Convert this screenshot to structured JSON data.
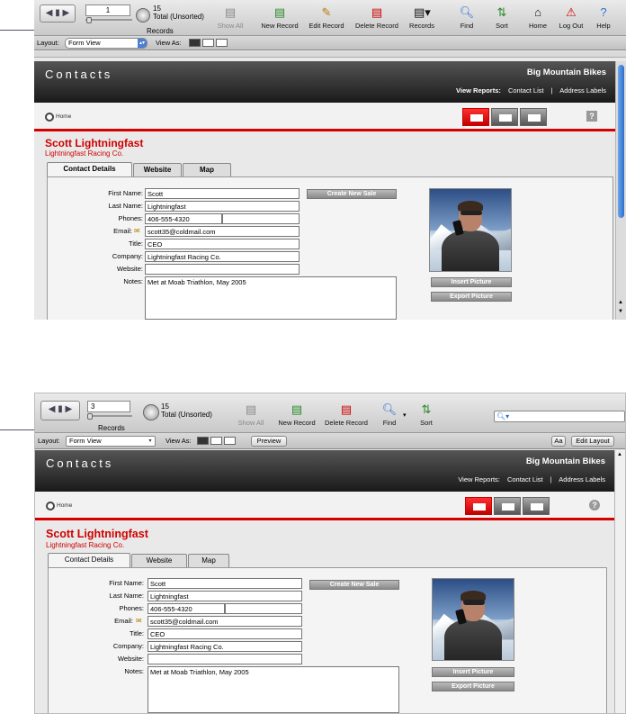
{
  "panel1": {
    "toolbar": {
      "record_number": "1",
      "total_count": "15",
      "total_state": "Total (Unsorted)",
      "records_label": "Records",
      "buttons": [
        {
          "label": "Show All",
          "icon": "show-all-icon",
          "enabled": false
        },
        {
          "label": "New Record",
          "icon": "new-record-icon",
          "enabled": true
        },
        {
          "label": "Edit Record",
          "icon": "edit-record-icon",
          "enabled": true
        },
        {
          "label": "Delete Record",
          "icon": "delete-record-icon",
          "enabled": true
        },
        {
          "label": "Records",
          "icon": "records-menu-icon",
          "enabled": true
        },
        {
          "label": "Find",
          "icon": "find-icon",
          "enabled": true
        },
        {
          "label": "Sort",
          "icon": "sort-icon",
          "enabled": true
        },
        {
          "label": "Home",
          "icon": "home-icon",
          "enabled": true
        },
        {
          "label": "Log Out",
          "icon": "log-out-icon",
          "enabled": true
        },
        {
          "label": "Help",
          "icon": "help-icon",
          "enabled": true
        }
      ]
    },
    "layout_bar": {
      "layout_label": "Layout:",
      "layout_value": "Form View",
      "view_as_label": "View As:"
    }
  },
  "panel2": {
    "toolbar": {
      "record_number": "3",
      "total_count": "15",
      "total_state": "Total (Unsorted)",
      "records_label": "Records",
      "buttons": [
        {
          "label": "Show All",
          "icon": "show-all-icon",
          "enabled": false
        },
        {
          "label": "New Record",
          "icon": "new-record-icon",
          "enabled": true
        },
        {
          "label": "Delete Record",
          "icon": "delete-record-icon",
          "enabled": true
        },
        {
          "label": "Find",
          "icon": "find-icon",
          "enabled": true
        },
        {
          "label": "Sort",
          "icon": "sort-icon",
          "enabled": true
        }
      ],
      "search_placeholder": ""
    },
    "layout_bar": {
      "layout_label": "Layout:",
      "layout_value": "Form View",
      "view_as_label": "View As:",
      "preview_label": "Preview",
      "text_format_label": "Aa",
      "edit_layout_label": "Edit Layout"
    }
  },
  "content": {
    "header_title": "Contacts",
    "company": "Big Mountain Bikes",
    "view_reports_label": "View Reports:",
    "contact_list_link": "Contact List",
    "separator": "|",
    "address_labels_link": "Address Labels",
    "home_label": "Home",
    "help_label": "?",
    "contact_name": "Scott Lightningfast",
    "contact_company": "Lightningfast Racing Co.",
    "tabs": [
      "Contact Details",
      "Website",
      "Map"
    ],
    "fields": [
      {
        "label": "First Name:",
        "value": "Scott"
      },
      {
        "label": "Last Name:",
        "value": "Lightningfast"
      },
      {
        "label": "Phones:",
        "value": "406-555-4320"
      },
      {
        "label": "Email:",
        "value": "scott35@coldmail.com"
      },
      {
        "label": "Title:",
        "value": "CEO"
      },
      {
        "label": "Company:",
        "value": "Lightningfast Racing Co."
      },
      {
        "label": "Website:",
        "value": ""
      },
      {
        "label": "Notes:",
        "value": "Met at Moab Triathlon, May 2005"
      }
    ],
    "create_sale_button": "Create New Sale",
    "insert_picture_button": "Insert Picture",
    "export_picture_button": "Export Picture"
  },
  "colors": {
    "accent_red": "#d40000",
    "header_dark": "#1a1a1a"
  }
}
